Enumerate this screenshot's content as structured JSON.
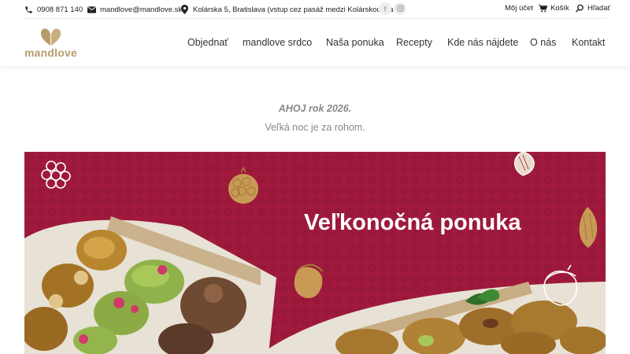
{
  "topbar": {
    "phone": "0908 871 140",
    "email": "mandlove@mandlove.sk",
    "address": "Kolárska 5, Bratislava (vstup cez pasáž medzi Kolárskou 5 a 7)",
    "social_facebook": "f",
    "account_label": "Môj účet",
    "cart_label": "Košík",
    "search_label": "Hľadať"
  },
  "header": {
    "logo_text": "mandlove",
    "nav": [
      "Objednať",
      "mandlove srdco",
      "Naša ponuka",
      "Recepty",
      "Kde nás nájdete",
      "O nás",
      "Kontakt"
    ]
  },
  "main": {
    "intro_bold": "AHOJ rok 2026.",
    "intro_sub": "Veľká noc je za rohom.",
    "banner_title": "Veľkonočná ponuka"
  },
  "colors": {
    "brand": "#b89b6c",
    "banner_red": "#a11a3d",
    "text_muted": "#888888"
  }
}
